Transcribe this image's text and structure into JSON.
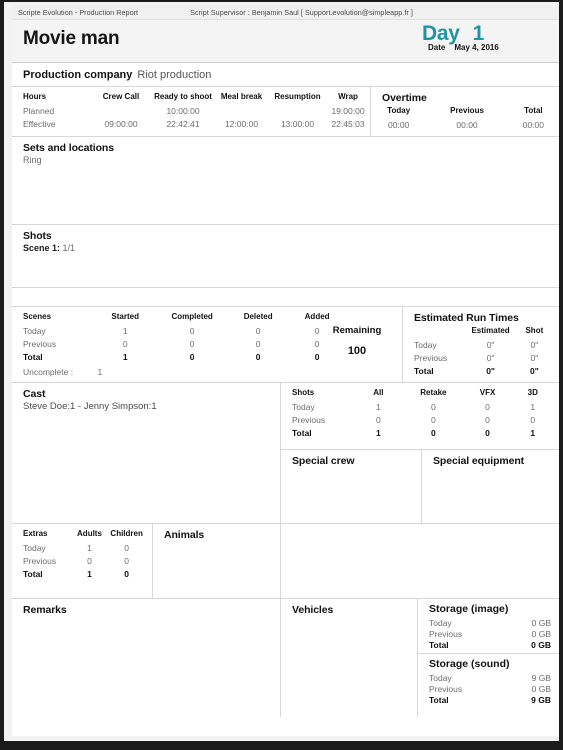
{
  "meta": {
    "app_label": "Scripte Evolution - Production Report",
    "supervisor_label": "Script Supervisor :  Benjamin Saul [ Support.evolution@simpleapp.fr ]"
  },
  "header": {
    "movie_title": "Movie man",
    "day_word": "Day",
    "day_number": "1",
    "date_label": "Date",
    "date_value": "May 4, 2016",
    "accent_color": "#1f93a8"
  },
  "production": {
    "label": "Production company",
    "value": "Riot production"
  },
  "hours": {
    "title": "Hours",
    "columns": [
      "Crew Call",
      "Ready to shoot",
      "Meal break",
      "Resumption",
      "Wrap"
    ],
    "rows": [
      {
        "label": "Planned",
        "values": [
          "",
          "10:00:00",
          "",
          "",
          "19:00:00"
        ]
      },
      {
        "label": "Effective",
        "values": [
          "09:00:00",
          "22:42:41",
          "12:00:00",
          "13:00:00",
          "22:45:03"
        ]
      }
    ]
  },
  "overtime": {
    "title": "Overtime",
    "columns": [
      "Today",
      "Previous",
      "Total"
    ],
    "values": [
      "00:00",
      "00:00",
      "00:00"
    ]
  },
  "sets_and_locations": {
    "title": "Sets and locations",
    "value": "Ring"
  },
  "shots_scene": {
    "title": "Shots",
    "scene_label": "Scene 1:",
    "scene_value": "1/1"
  },
  "scenes": {
    "title": "Scenes",
    "columns": [
      "Started",
      "Completed",
      "Deleted",
      "Added"
    ],
    "rows": [
      {
        "label": "Today",
        "values": [
          "1",
          "0",
          "0",
          "0"
        ]
      },
      {
        "label": "Previous",
        "values": [
          "0",
          "0",
          "0",
          "0"
        ]
      },
      {
        "label": "Total",
        "values": [
          "1",
          "0",
          "0",
          "0"
        ]
      }
    ],
    "uncomplete_label": "Uncomplete :",
    "uncomplete_value": "1",
    "remaining_label": "Remaining",
    "remaining_value": "100"
  },
  "estimated_run_times": {
    "title": "Estimated Run Times",
    "columns": [
      "Estimated",
      "Shot"
    ],
    "rows": [
      {
        "label": "Today",
        "values": [
          "0\"",
          "0\""
        ]
      },
      {
        "label": "Previous",
        "values": [
          "0\"",
          "0\""
        ]
      },
      {
        "label": "Total",
        "values": [
          "0\"",
          "0\""
        ]
      }
    ]
  },
  "cast": {
    "title": "Cast",
    "names": "Steve Doe:1 - Jenny Simpson:1"
  },
  "shots_table": {
    "title": "Shots",
    "columns": [
      "All",
      "Retake",
      "VFX",
      "3D"
    ],
    "rows": [
      {
        "label": "Today",
        "values": [
          "1",
          "0",
          "0",
          "1"
        ]
      },
      {
        "label": "Previous",
        "values": [
          "0",
          "0",
          "0",
          "0"
        ]
      },
      {
        "label": "Total",
        "values": [
          "1",
          "0",
          "0",
          "1"
        ]
      }
    ]
  },
  "special_crew": {
    "title": "Special crew",
    "value": ""
  },
  "special_equipment": {
    "title": "Special equipment",
    "value": ""
  },
  "extras": {
    "title": "Extras",
    "columns": [
      "Adults",
      "Children"
    ],
    "rows": [
      {
        "label": "Today",
        "values": [
          "1",
          "0"
        ]
      },
      {
        "label": "Previous",
        "values": [
          "0",
          "0"
        ]
      },
      {
        "label": "Total",
        "values": [
          "1",
          "0"
        ]
      }
    ]
  },
  "animals": {
    "title": "Animals",
    "value": ""
  },
  "remarks": {
    "title": "Remarks",
    "value": ""
  },
  "vehicles": {
    "title": "Vehicles",
    "value": ""
  },
  "storage_image": {
    "title": "Storage (image)",
    "rows": [
      {
        "label": "Today",
        "value": "0 GB"
      },
      {
        "label": "Previous",
        "value": "0 GB"
      },
      {
        "label": "Total",
        "value": "0 GB"
      }
    ]
  },
  "storage_sound": {
    "title": "Storage (sound)",
    "rows": [
      {
        "label": "Today",
        "value": "9 GB"
      },
      {
        "label": "Previous",
        "value": "0 GB"
      },
      {
        "label": "Total",
        "value": "9 GB"
      }
    ]
  }
}
